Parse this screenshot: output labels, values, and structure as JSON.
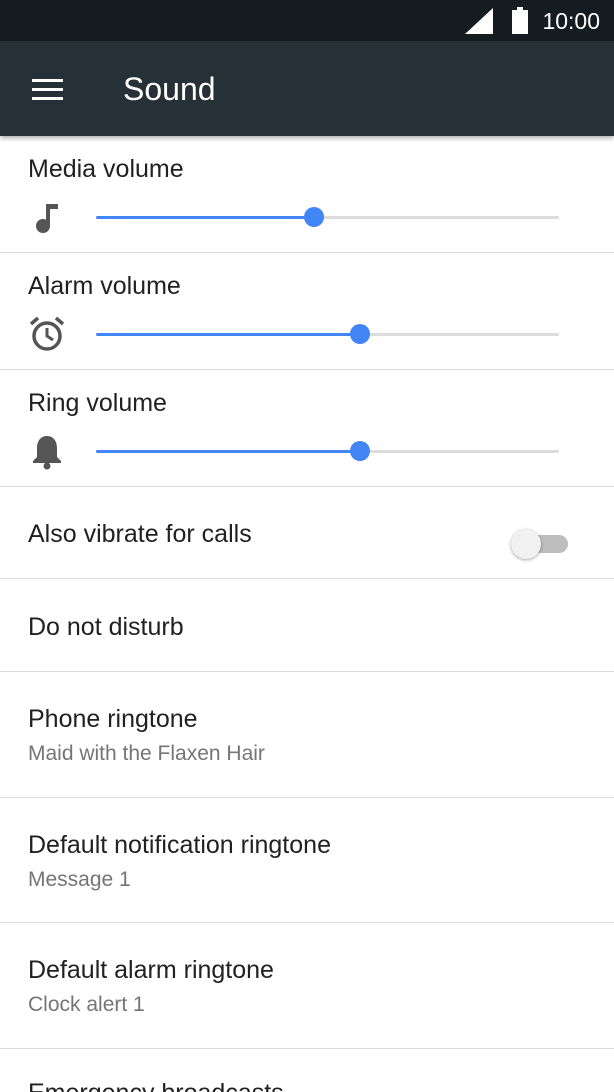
{
  "status_bar": {
    "time": "10:00",
    "signal_icon": "cell-signal-icon",
    "battery_icon": "battery-full-icon"
  },
  "app_bar": {
    "menu_icon": "hamburger-menu-icon",
    "title": "Sound"
  },
  "volume": [
    {
      "label": "Media volume",
      "icon": "music-note-icon",
      "level_percent": 47
    },
    {
      "label": "Alarm volume",
      "icon": "alarm-clock-icon",
      "level_percent": 57
    },
    {
      "label": "Ring volume",
      "icon": "bell-icon",
      "level_percent": 57
    }
  ],
  "vibrate": {
    "label": "Also vibrate for calls",
    "enabled": false
  },
  "dnd": {
    "label": "Do not disturb"
  },
  "ringtones": [
    {
      "label": "Phone ringtone",
      "summary": "Maid with the Flaxen Hair"
    },
    {
      "label": "Default notification ringtone",
      "summary": "Message 1"
    },
    {
      "label": "Default alarm ringtone",
      "summary": "Clock alert 1"
    }
  ],
  "emergency": {
    "label": "Emergency broadcasts"
  },
  "colors": {
    "accent": "#4285f4",
    "app_bar": "#263037",
    "status_bar": "#161b20"
  }
}
